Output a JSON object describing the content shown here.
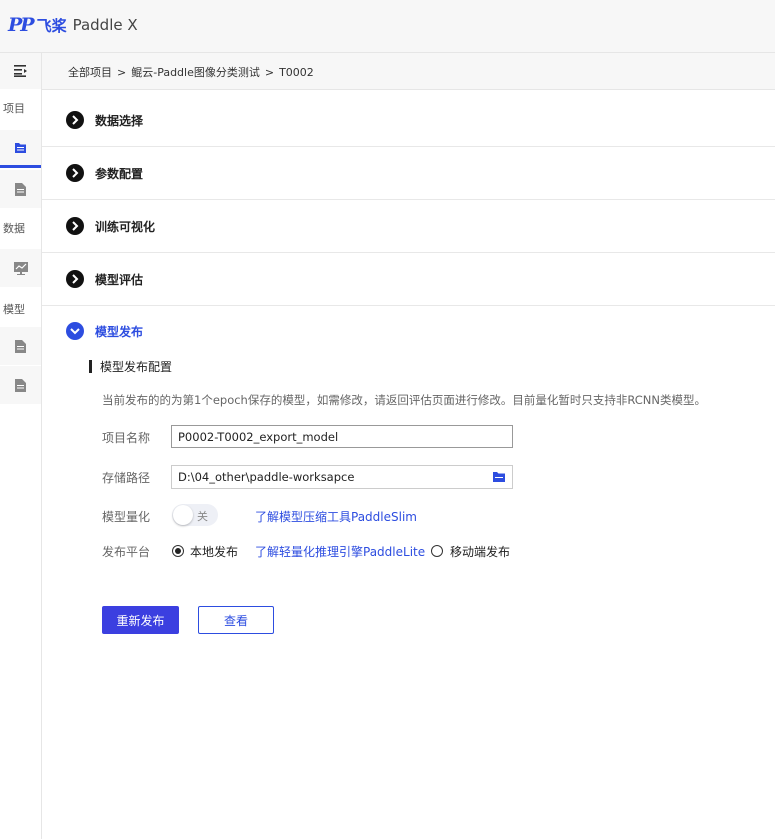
{
  "header": {
    "logo_mark": "PP",
    "brand_cn": "飞桨",
    "brand_en": "Paddle X"
  },
  "sidebar": {
    "toggle_icon": "menu-collapse-icon",
    "groups": [
      {
        "label": "项目",
        "items": [
          "file-icon",
          "document-icon"
        ]
      },
      {
        "label": "数据",
        "items": [
          "chart-icon"
        ]
      },
      {
        "label": "模型",
        "items": [
          "document-icon",
          "document-icon"
        ]
      }
    ]
  },
  "breadcrumb": {
    "items": [
      "全部项目",
      "鲲云-Paddle图像分类测试",
      "T0002"
    ],
    "separator": ">"
  },
  "sections": [
    {
      "title": "数据选择",
      "expanded": false
    },
    {
      "title": "参数配置",
      "expanded": false
    },
    {
      "title": "训练可视化",
      "expanded": false
    },
    {
      "title": "模型评估",
      "expanded": false
    },
    {
      "title": "模型发布",
      "expanded": true
    }
  ],
  "publish": {
    "subheading": "模型发布配置",
    "notice": "当前发布的的为第1个epoch保存的模型，如需修改，请返回评估页面进行修改。目前量化暂时只支持非RCNN类模型。",
    "name_label": "项目名称",
    "name_value": "P0002-T0002_export_model",
    "path_label": "存储路径",
    "path_value": "D:\\04_other\\paddle-worksapce",
    "quant_label": "模型量化",
    "quant_toggle_text": "关",
    "quant_enabled": false,
    "quant_link": "了解模型压缩工具PaddleSlim",
    "platform_label": "发布平台",
    "platform_local": "本地发布",
    "platform_link": "了解轻量化推理引擎PaddleLite",
    "platform_mobile": "移动端发布",
    "selected_platform": "本地发布",
    "republish_button": "重新发布",
    "view_button": "查看"
  },
  "colors": {
    "accent": "#2d4de0",
    "primary_button": "#3b3fe0"
  }
}
